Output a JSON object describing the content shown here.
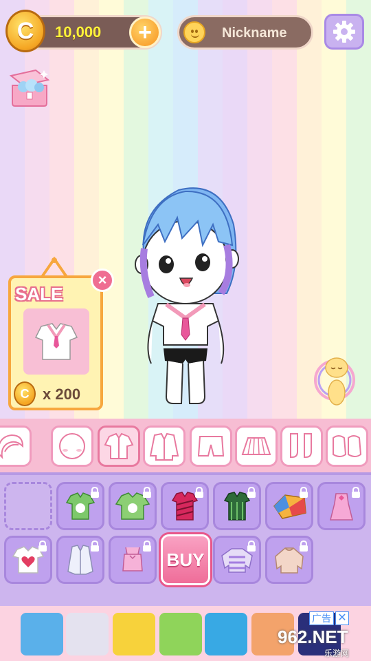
{
  "top_bar": {
    "coin_symbol": "C",
    "coins": "10,000",
    "add_coins_symbol": "+",
    "nickname": "Nickname"
  },
  "sale_popup": {
    "label": "SALE",
    "price": "x 200",
    "coin_symbol": "C",
    "close_symbol": "×"
  },
  "categories": [
    {
      "icon": "hair-icon",
      "active": false
    },
    {
      "icon": "face-icon",
      "active": false
    },
    {
      "icon": "shirt-icon",
      "active": true
    },
    {
      "icon": "jacket-icon",
      "active": false
    },
    {
      "icon": "shorts-icon",
      "active": false
    },
    {
      "icon": "skirt-icon",
      "active": false
    },
    {
      "icon": "socks-icon",
      "active": false
    },
    {
      "icon": "shoes-icon",
      "active": false
    }
  ],
  "items": [
    {
      "icon": "empty-slot",
      "locked": false
    },
    {
      "icon": "green-tee-icon",
      "locked": true
    },
    {
      "icon": "green-tee-icon",
      "locked": true
    },
    {
      "icon": "striped-red-top-icon",
      "locked": true
    },
    {
      "icon": "watermelon-top-icon",
      "locked": true
    },
    {
      "icon": "colorblock-top-icon",
      "locked": true
    },
    {
      "icon": "pink-dress-top-icon",
      "locked": true
    },
    {
      "icon": "heart-tee-icon",
      "locked": true
    },
    {
      "icon": "white-shirt-icon",
      "locked": true
    },
    {
      "icon": "pink-camisole-icon",
      "locked": true
    },
    {
      "icon": "buy-button",
      "locked": false
    },
    {
      "icon": "striped-sweater-icon",
      "locked": true
    },
    {
      "icon": "beige-sweater-icon",
      "locked": true
    }
  ],
  "buy_label": "BUY",
  "ad": {
    "label": "广告",
    "close_symbol": "✕",
    "watermark": "962.NET",
    "watermark_sub": "乐游网"
  },
  "colors": {
    "accent_pink": "#ef6d99",
    "panel_purple": "#cdb5ee",
    "category_pink": "#f7bdd3",
    "coin_gold": "#f5a623"
  }
}
